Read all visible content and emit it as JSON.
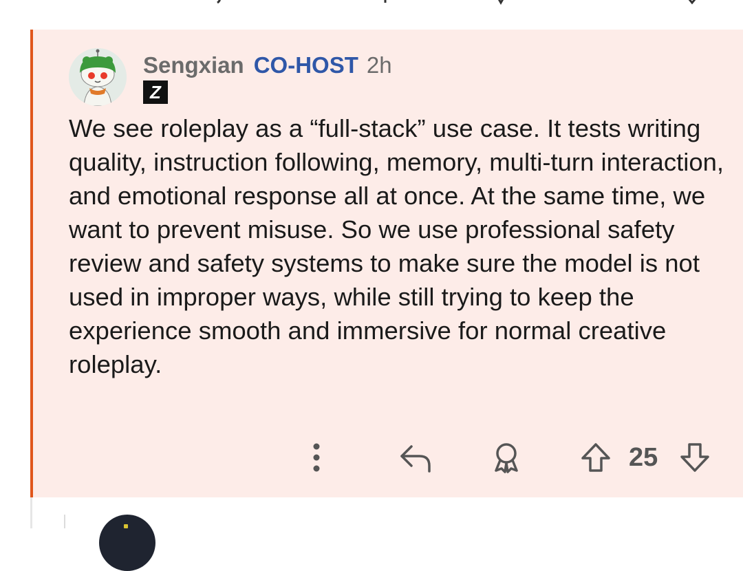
{
  "comment": {
    "username": "Sengxian",
    "role_badge": "CO-HOST",
    "time_ago": "2h",
    "flair_letter": "Z",
    "body": "We see roleplay as a “full-stack” use case. It tests writing quality, instruction following, memory, multi-turn interaction, and emotional response all at once. At the same time, we want to prevent misuse. So we use professional safety review and safety systems to make sure the model is not used in improper ways, while still trying to keep the experience smooth and immersive for normal creative roleplay.",
    "vote_count": "25"
  },
  "icons": [
    "more-options-icon",
    "reply-icon",
    "award-icon",
    "upvote-icon",
    "downvote-icon"
  ],
  "colors": {
    "comment_background": "#fdece8",
    "highlight_border": "#e0561c",
    "role_badge": "#2f57a8",
    "meta_text": "#6b6b6b",
    "body_text": "#1a1a1a"
  }
}
